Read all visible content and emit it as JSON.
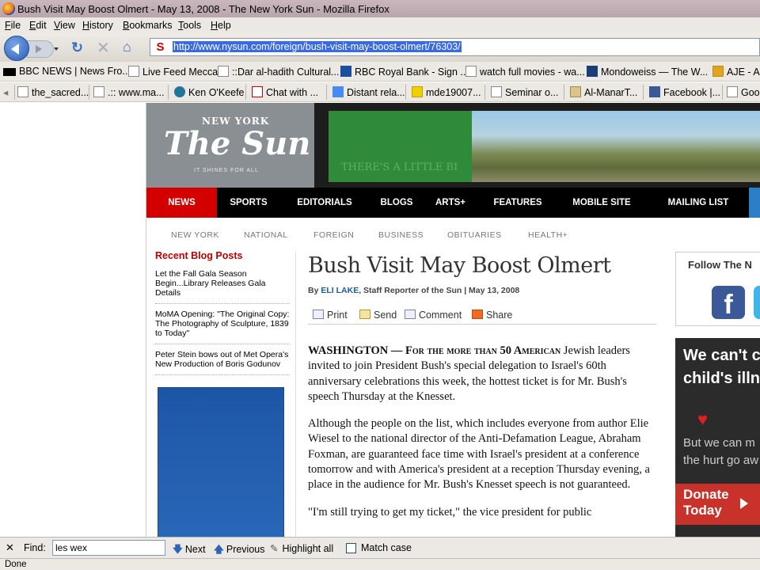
{
  "window": {
    "title": "Bush Visit May Boost Olmert - May 13, 2008 - The New York Sun - Mozilla Firefox"
  },
  "menu": [
    "File",
    "Edit",
    "View",
    "History",
    "Bookmarks",
    "Tools",
    "Help"
  ],
  "address": {
    "url": "http://www.nysun.com/foreign/bush-visit-may-boost-olmert/76303/"
  },
  "bookmarks1": [
    "BBC NEWS | News Fro...",
    "Live Feed Mecca",
    "::Dar al-hadith Cultural...",
    "RBC Royal Bank - Sign ...",
    "watch full movies - wa...",
    "Mondoweiss — The W...",
    "AJE - Al"
  ],
  "tabs": [
    "the_sacred...",
    ".:: www.ma...",
    "Ken O'Keefe",
    "Chat with ...",
    "Distant rela...",
    "mde19007...",
    "Seminar o...",
    "Al-ManarT...",
    "Facebook |...",
    "Goo"
  ],
  "site": {
    "masthead_top": "NEW YORK",
    "masthead_name": "The Sun",
    "masthead_slogan": "IT SHINES FOR ALL",
    "ad_text": "THERE'S A LITTLE BI",
    "nav": [
      "NEWS",
      "SPORTS",
      "EDITORIALS",
      "BLOGS",
      "ARTS+",
      "FEATURES",
      "MOBILE SITE",
      "MAILING LIST"
    ],
    "subnav": [
      "NEW YORK",
      "NATIONAL",
      "FOREIGN",
      "BUSINESS",
      "OBITUARIES",
      "HEALTH+"
    ]
  },
  "sidebar": {
    "heading": "Recent Blog Posts",
    "posts": [
      "Let the Fall Gala Season Begin...Library Releases Gala Details",
      "MoMA Opening: \"The Original Copy: The Photography of Sculpture, 1839 to Today\"",
      "Peter Stein bows out of Met Opera's New Production of Boris Godunov"
    ]
  },
  "article": {
    "headline": "Bush Visit May Boost Olmert",
    "by": "By",
    "author": "ELI LAKE",
    "role": ", Staff Reporter of the Sun | May 13, 2008",
    "tools": [
      "Print",
      "Send",
      "Comment",
      "Share"
    ],
    "dateline": "WASHINGTON — For the more than 50 American",
    "p1_rest": "Jewish leaders invited to join President Bush's special delegation to Israel's 60th anniversary celebrations this week, the hottest ticket is for Mr. Bush's speech Thursday at the Knesset.",
    "p2": "Although the people on the list, which includes everyone from author Elie Wiesel to the national director of the Anti-Defamation League, Abraham Foxman, are guaranteed face time with Israel's president at a conference tomorrow and with America's president at a reception Thursday evening, a place in the audience for Mr. Bush's Knesset speech is not guaranteed.",
    "p3": "\"I'm still trying to get my ticket,\" the vice president for public"
  },
  "right": {
    "follow": "Follow The N",
    "ad_head1": "We can't c",
    "ad_head2": "child's illn",
    "ad_sub1": "But we can m",
    "ad_sub2": "the hurt go aw",
    "donate1": "Donate",
    "donate2": "Today"
  },
  "findbar": {
    "label": "Find:",
    "value": "les wex",
    "next": "Next",
    "previous": "Previous",
    "highlight": "Highlight all",
    "matchcase": "Match case"
  },
  "status": "Done"
}
